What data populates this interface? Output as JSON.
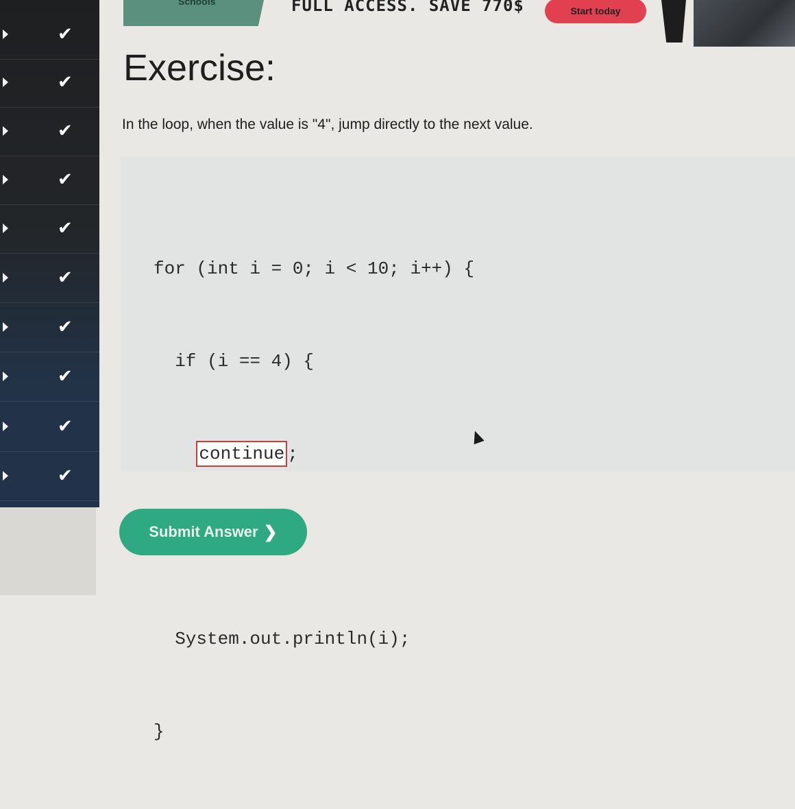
{
  "banner": {
    "left_label": "Schools",
    "promo": "FULL ACCESS. SAVE 770$",
    "cta": "Start today"
  },
  "sidebar": {
    "items": [
      {
        "status": "check"
      },
      {
        "status": "check"
      },
      {
        "status": "check"
      },
      {
        "status": "check"
      },
      {
        "status": "check"
      },
      {
        "status": "check"
      },
      {
        "status": "check"
      },
      {
        "status": "check"
      },
      {
        "status": "check"
      },
      {
        "status": "check"
      }
    ],
    "check_glyph": "✔",
    "icons": [
      "chevron-right-icon",
      "check-icon"
    ]
  },
  "exercise": {
    "title": "Exercise:",
    "description": "In the loop, when the value is \"4\", jump directly to the next value."
  },
  "code": {
    "line1": "for (int i = 0; i < 10; i++) {",
    "line2": "  if (i == 4) {",
    "line3_indent": "    ",
    "answer_value": "continue",
    "line3_suffix": ";",
    "line4": "  }",
    "line5": "  System.out.println(i);",
    "line6": "}"
  },
  "submit": {
    "label": "Submit Answer",
    "arrow": "❯"
  },
  "colors": {
    "accent_green": "#2fa982",
    "cta_red": "#e0404f",
    "answer_border": "#d23a3a"
  }
}
